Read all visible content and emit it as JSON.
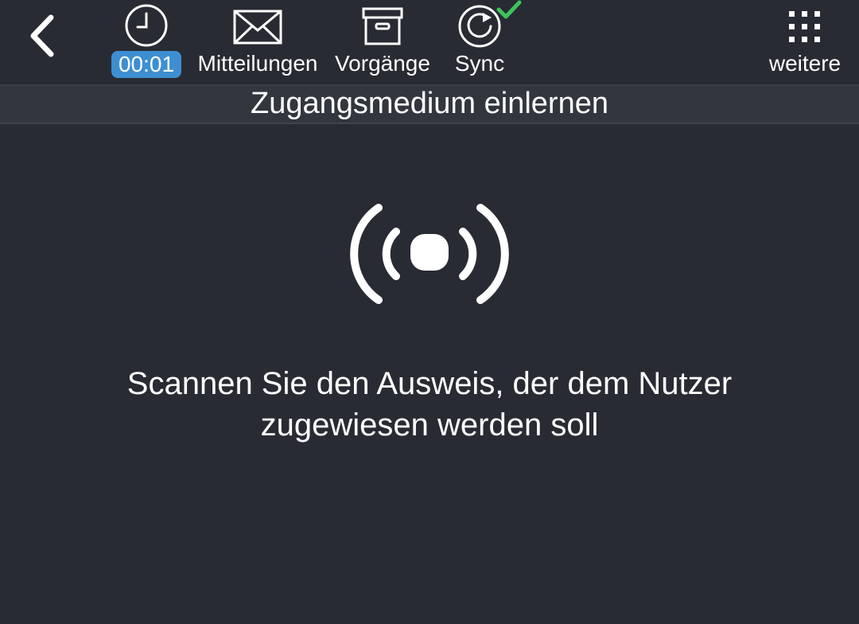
{
  "toolbar": {
    "back": {
      "icon": "chevron-left-icon"
    },
    "timer": {
      "value": "00:01",
      "icon": "clock-icon",
      "badge_color": "#3d8fd1"
    },
    "messages": {
      "label": "Mitteilungen",
      "icon": "envelope-icon"
    },
    "processes": {
      "label": "Vorgänge",
      "icon": "archive-box-icon"
    },
    "sync": {
      "label": "Sync",
      "icon": "sync-icon",
      "status_icon": "checkmark-icon",
      "status_color": "#3cc45a"
    },
    "more": {
      "label": "weitere",
      "icon": "grid-dots-icon"
    }
  },
  "title": "Zugangsmedium einlernen",
  "main": {
    "icon": "nfc-scan-icon",
    "instruction_line1": "Scannen Sie den Ausweis, der dem Nutzer",
    "instruction_line2": "zugewiesen werden soll"
  },
  "colors": {
    "background": "#282b33",
    "titlebar": "#32363f",
    "accent": "#3d8fd1"
  }
}
